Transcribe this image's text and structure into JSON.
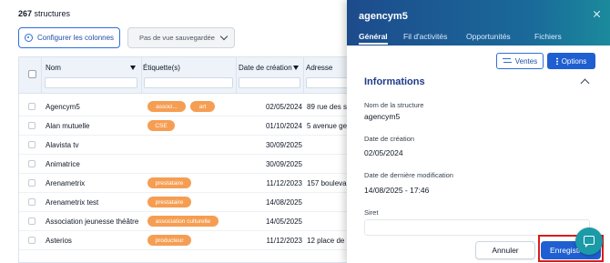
{
  "list": {
    "count_number": "267",
    "count_label": "structures",
    "configure_columns_label": "Configurer les colonnes",
    "view_select_value": "Pas de vue sauvegardée",
    "columns": {
      "name": "Nom",
      "tags": "Étiquette(s)",
      "created": "Date de création",
      "address": "Adresse"
    },
    "rows": [
      {
        "name": "Agencym5",
        "tags": [
          "associ...",
          "art"
        ],
        "date": "02/05/2024",
        "address": "89 rue des sé"
      },
      {
        "name": "Alan mutuelle",
        "tags": [
          "CSE"
        ],
        "date": "01/10/2024",
        "address": "5 avenue gec"
      },
      {
        "name": "Alavista tv",
        "tags": [],
        "date": "30/09/2025",
        "address": ""
      },
      {
        "name": "Animatrice",
        "tags": [],
        "date": "30/09/2025",
        "address": ""
      },
      {
        "name": "Arenametrix",
        "tags": [
          "prestataire"
        ],
        "date": "11/12/2023",
        "address": "157 boulevar"
      },
      {
        "name": "Arenametrix test",
        "tags": [
          "prestataire"
        ],
        "date": "14/08/2025",
        "address": ""
      },
      {
        "name": "Association jeunesse théâtre",
        "tags": [
          "association culturelle"
        ],
        "date": "14/05/2025",
        "address": ""
      },
      {
        "name": "Asterios",
        "tags": [
          "producteur"
        ],
        "date": "11/12/2023",
        "address": "12 place de la"
      }
    ]
  },
  "panel": {
    "title": "agencym5",
    "tabs": [
      "Général",
      "Fil d'activités",
      "Opportunités",
      "Fichiers"
    ],
    "ventes_label": "Ventes",
    "options_label": "Options",
    "section_title": "Informations",
    "fields": [
      {
        "label": "Nom de la structure",
        "value": "agencym5"
      },
      {
        "label": "Date de création",
        "value": "02/05/2024"
      },
      {
        "label": "Date de dernière modification",
        "value": "14/08/2025 - 17:46"
      },
      {
        "label": "Siret",
        "value": ""
      }
    ],
    "cancel_label": "Annuler",
    "save_label": "Enregistrer"
  },
  "colors": {
    "accent": "#1f5fd1",
    "tag": "#f59e53",
    "header_gradient_start": "#1d4b8c",
    "header_gradient_end": "#1b8a9c",
    "highlight": "#d91c1c",
    "chat": "#1b9aa8"
  },
  "icons": [
    "settings-icon",
    "chevron-down-icon",
    "sort-desc-icon",
    "close-icon",
    "swap-icon",
    "kebab-icon",
    "chevron-up-icon",
    "chat-icon"
  ]
}
